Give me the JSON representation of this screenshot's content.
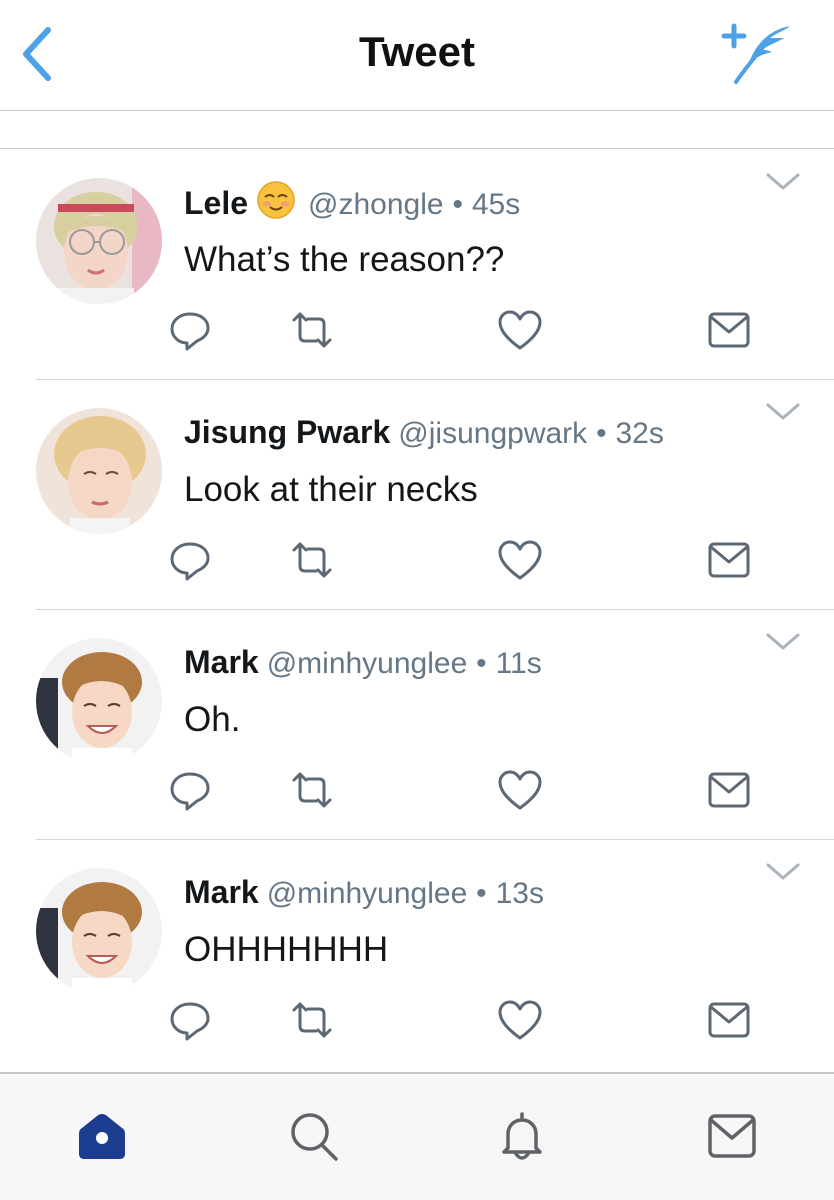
{
  "header": {
    "title": "Tweet",
    "back_icon": "chevron-left-icon",
    "compose_icon": "compose-tweet-feather-icon",
    "accent_color": "#4da1e6"
  },
  "tweets": [
    {
      "name": "Lele",
      "emoji": "☺️",
      "handle": "@zhongle",
      "separator": "•",
      "time": "45s",
      "text": "What’s the reason??"
    },
    {
      "name": "Jisung Pwark",
      "handle": "@jisungpwark",
      "separator": "•",
      "time": "32s",
      "text": "Look at their necks"
    },
    {
      "name": "Mark",
      "handle": "@minhyunglee",
      "separator": "•",
      "time": "11s",
      "text": "Oh."
    },
    {
      "name": "Mark",
      "handle": "@minhyunglee",
      "separator": "•",
      "time": "13s",
      "text": "OHHHHHHH"
    }
  ],
  "action_icons": [
    "reply-icon",
    "retweet-icon",
    "like-heart-icon",
    "direct-message-icon"
  ],
  "tabbar": {
    "tabs": [
      "home-icon",
      "search-icon",
      "notifications-bell-icon",
      "messages-envelope-icon"
    ],
    "active_color": "#1b3c8f",
    "inactive_color": "#5f6368"
  }
}
